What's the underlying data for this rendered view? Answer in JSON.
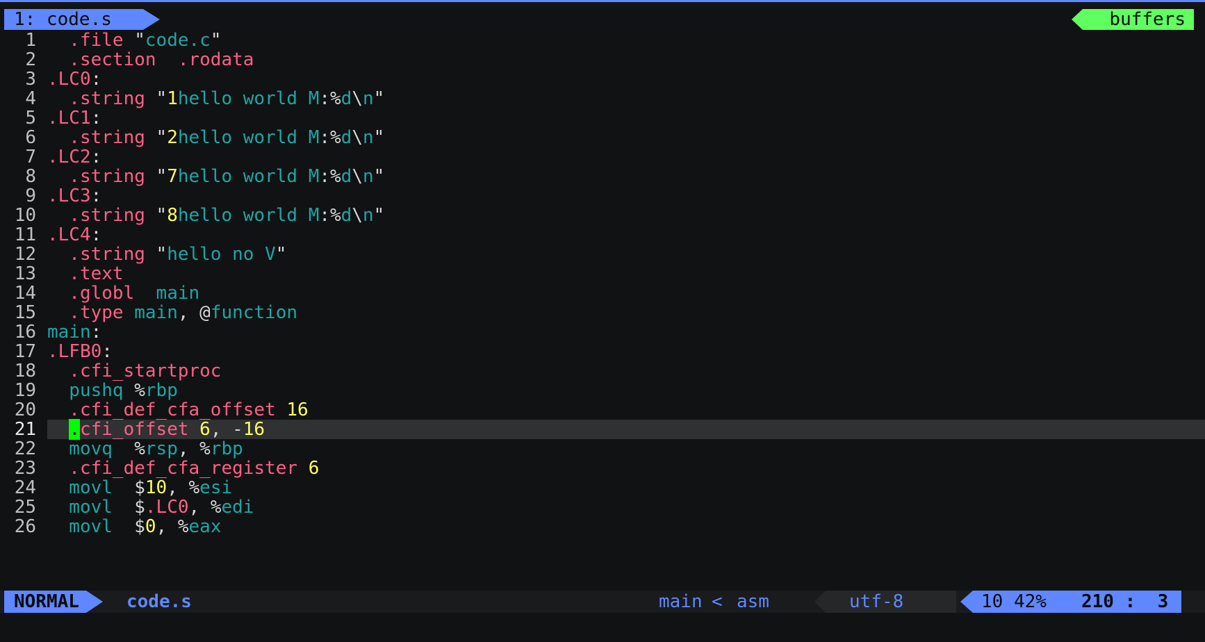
{
  "tabline": {
    "active_tab": "1: code.s",
    "right_label": "buffers"
  },
  "editor": {
    "lines": [
      {
        "num": "1",
        "tokens": [
          {
            "t": "  .file ",
            "c": "dir"
          },
          {
            "t": "\"",
            "c": "pun"
          },
          {
            "t": "code.c",
            "c": "str"
          },
          {
            "t": "\"",
            "c": "pun"
          }
        ]
      },
      {
        "num": "2",
        "tokens": [
          {
            "t": "  .section  .rodata",
            "c": "dir"
          }
        ]
      },
      {
        "num": "3",
        "tokens": [
          {
            "t": ".LC0",
            "c": "lbl"
          },
          {
            "t": ":",
            "c": "pun"
          }
        ]
      },
      {
        "num": "4",
        "tokens": [
          {
            "t": "  .string ",
            "c": "dir"
          },
          {
            "t": "\"",
            "c": "pun"
          },
          {
            "t": "1",
            "c": "num"
          },
          {
            "t": "hello world M",
            "c": "str"
          },
          {
            "t": ":%",
            "c": "pun"
          },
          {
            "t": "d",
            "c": "str"
          },
          {
            "t": "\\",
            "c": "pun"
          },
          {
            "t": "n",
            "c": "str"
          },
          {
            "t": "\"",
            "c": "pun"
          }
        ]
      },
      {
        "num": "5",
        "tokens": [
          {
            "t": ".LC1",
            "c": "lbl"
          },
          {
            "t": ":",
            "c": "pun"
          }
        ]
      },
      {
        "num": "6",
        "tokens": [
          {
            "t": "  .string ",
            "c": "dir"
          },
          {
            "t": "\"",
            "c": "pun"
          },
          {
            "t": "2",
            "c": "num"
          },
          {
            "t": "hello world M",
            "c": "str"
          },
          {
            "t": ":%",
            "c": "pun"
          },
          {
            "t": "d",
            "c": "str"
          },
          {
            "t": "\\",
            "c": "pun"
          },
          {
            "t": "n",
            "c": "str"
          },
          {
            "t": "\"",
            "c": "pun"
          }
        ]
      },
      {
        "num": "7",
        "tokens": [
          {
            "t": ".LC2",
            "c": "lbl"
          },
          {
            "t": ":",
            "c": "pun"
          }
        ]
      },
      {
        "num": "8",
        "tokens": [
          {
            "t": "  .string ",
            "c": "dir"
          },
          {
            "t": "\"",
            "c": "pun"
          },
          {
            "t": "7",
            "c": "num"
          },
          {
            "t": "hello world M",
            "c": "str"
          },
          {
            "t": ":%",
            "c": "pun"
          },
          {
            "t": "d",
            "c": "str"
          },
          {
            "t": "\\",
            "c": "pun"
          },
          {
            "t": "n",
            "c": "str"
          },
          {
            "t": "\"",
            "c": "pun"
          }
        ]
      },
      {
        "num": "9",
        "tokens": [
          {
            "t": ".LC3",
            "c": "lbl"
          },
          {
            "t": ":",
            "c": "pun"
          }
        ]
      },
      {
        "num": "10",
        "tokens": [
          {
            "t": "  .string ",
            "c": "dir"
          },
          {
            "t": "\"",
            "c": "pun"
          },
          {
            "t": "8",
            "c": "num"
          },
          {
            "t": "hello world M",
            "c": "str"
          },
          {
            "t": ":%",
            "c": "pun"
          },
          {
            "t": "d",
            "c": "str"
          },
          {
            "t": "\\",
            "c": "pun"
          },
          {
            "t": "n",
            "c": "str"
          },
          {
            "t": "\"",
            "c": "pun"
          }
        ]
      },
      {
        "num": "11",
        "tokens": [
          {
            "t": ".LC4",
            "c": "lbl"
          },
          {
            "t": ":",
            "c": "pun"
          }
        ]
      },
      {
        "num": "12",
        "tokens": [
          {
            "t": "  .string ",
            "c": "dir"
          },
          {
            "t": "\"",
            "c": "pun"
          },
          {
            "t": "hello no V",
            "c": "str"
          },
          {
            "t": "\"",
            "c": "pun"
          }
        ]
      },
      {
        "num": "13",
        "tokens": [
          {
            "t": "  .text",
            "c": "dir"
          }
        ]
      },
      {
        "num": "14",
        "tokens": [
          {
            "t": "  .globl  ",
            "c": "dir"
          },
          {
            "t": "main",
            "c": "str"
          }
        ]
      },
      {
        "num": "15",
        "tokens": [
          {
            "t": "  .type ",
            "c": "dir"
          },
          {
            "t": "main",
            "c": "str"
          },
          {
            "t": ", @",
            "c": "pun"
          },
          {
            "t": "function",
            "c": "str"
          }
        ]
      },
      {
        "num": "16",
        "tokens": [
          {
            "t": "main",
            "c": "str"
          },
          {
            "t": ":",
            "c": "pun"
          }
        ]
      },
      {
        "num": "17",
        "tokens": [
          {
            "t": ".LFB0",
            "c": "lbl"
          },
          {
            "t": ":",
            "c": "pun"
          }
        ]
      },
      {
        "num": "18",
        "tokens": [
          {
            "t": "  .cfi_startproc",
            "c": "dir"
          }
        ]
      },
      {
        "num": "19",
        "tokens": [
          {
            "t": "  pushq ",
            "c": "ins"
          },
          {
            "t": "%",
            "c": "pun"
          },
          {
            "t": "rbp",
            "c": "reg"
          }
        ]
      },
      {
        "num": "20",
        "tokens": [
          {
            "t": "  .cfi_def_cfa_offset ",
            "c": "dir"
          },
          {
            "t": "16",
            "c": "num"
          }
        ]
      },
      {
        "num": "21",
        "current": true,
        "tokens": [
          {
            "t": "  ",
            "c": "pun"
          },
          {
            "t": ".",
            "c": "cursor"
          },
          {
            "t": "cfi_offset ",
            "c": "dir"
          },
          {
            "t": "6",
            "c": "num"
          },
          {
            "t": ", -",
            "c": "pun"
          },
          {
            "t": "16",
            "c": "num"
          }
        ]
      },
      {
        "num": "22",
        "tokens": [
          {
            "t": "  movq  ",
            "c": "ins"
          },
          {
            "t": "%",
            "c": "pun"
          },
          {
            "t": "rsp",
            "c": "reg"
          },
          {
            "t": ", %",
            "c": "pun"
          },
          {
            "t": "rbp",
            "c": "reg"
          }
        ]
      },
      {
        "num": "23",
        "tokens": [
          {
            "t": "  .cfi_def_cfa_register ",
            "c": "dir"
          },
          {
            "t": "6",
            "c": "num"
          }
        ]
      },
      {
        "num": "24",
        "tokens": [
          {
            "t": "  movl  ",
            "c": "ins"
          },
          {
            "t": "$",
            "c": "pun"
          },
          {
            "t": "10",
            "c": "num"
          },
          {
            "t": ", %",
            "c": "pun"
          },
          {
            "t": "esi",
            "c": "reg"
          }
        ]
      },
      {
        "num": "25",
        "tokens": [
          {
            "t": "  movl  ",
            "c": "ins"
          },
          {
            "t": "$",
            "c": "pun"
          },
          {
            "t": ".LC0",
            "c": "lbl"
          },
          {
            "t": ", %",
            "c": "pun"
          },
          {
            "t": "edi",
            "c": "reg"
          }
        ]
      },
      {
        "num": "26",
        "tokens": [
          {
            "t": "  movl  ",
            "c": "ins"
          },
          {
            "t": "$",
            "c": "pun"
          },
          {
            "t": "0",
            "c": "num"
          },
          {
            "t": ", %",
            "c": "pun"
          },
          {
            "t": "eax",
            "c": "reg"
          }
        ]
      }
    ]
  },
  "statusline": {
    "mode": "NORMAL",
    "filename": "code.s",
    "function": "main",
    "separator": "<",
    "filetype": "asm",
    "encoding": "utf-8",
    "percent": "10 42%",
    "position": "210 :  3"
  },
  "colors": {
    "accent": "#5f87ff",
    "buffers": "#5fff5f",
    "directive": "#ff5f87",
    "string": "#1fa5a5",
    "number": "#ffff5f",
    "cursor": "#00ff00"
  }
}
